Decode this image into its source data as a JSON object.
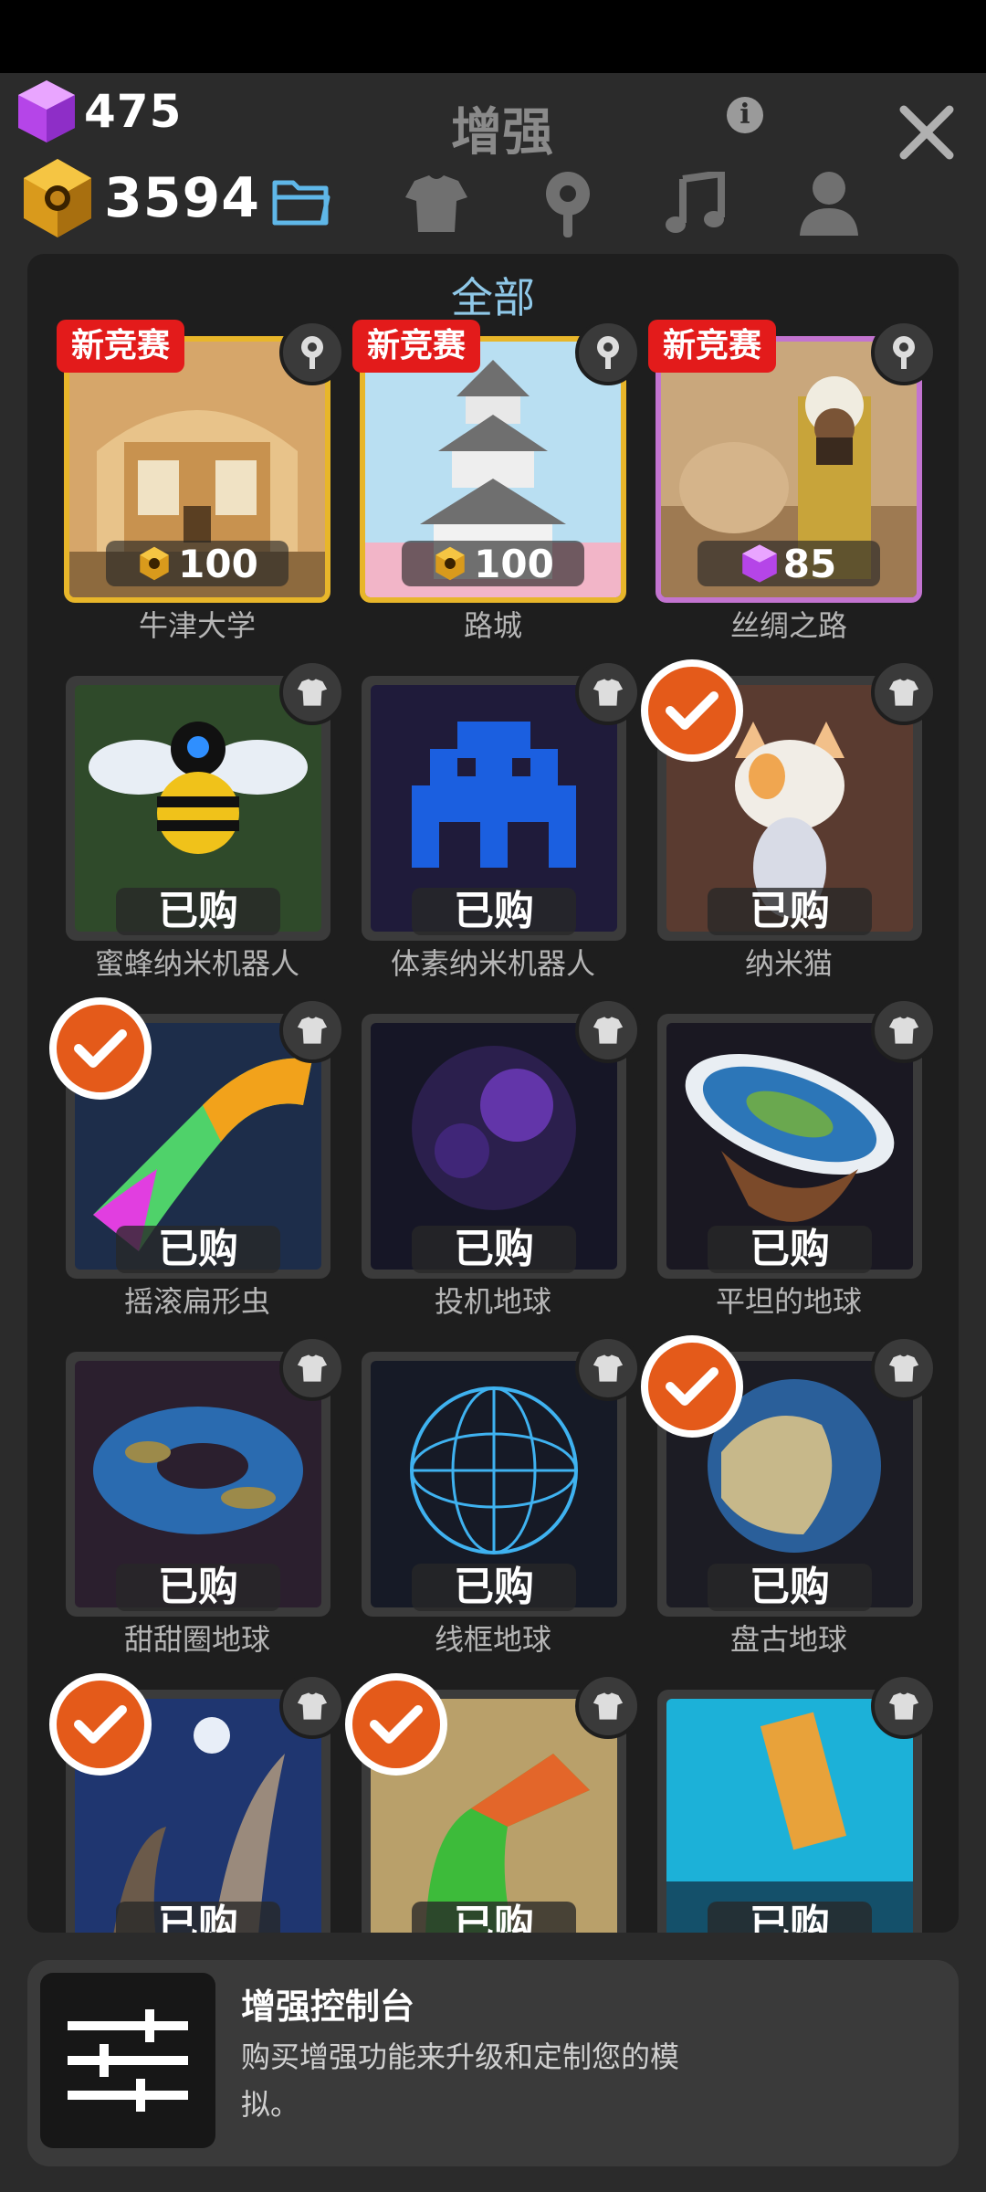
{
  "header": {
    "title": "增强",
    "gem_count": "475",
    "hex_count": "3594"
  },
  "panel": {
    "title": "全部"
  },
  "items": [
    {
      "name": "牛津大学",
      "type": "location",
      "new_tag": "新竞赛",
      "price": "100",
      "currency": "hex"
    },
    {
      "name": "路城",
      "type": "location",
      "new_tag": "新竞赛",
      "price": "100",
      "currency": "hex"
    },
    {
      "name": "丝绸之路",
      "type": "location",
      "new_tag": "新竞赛",
      "price": "85",
      "currency": "gem"
    },
    {
      "name": "蜜蜂纳米机器人",
      "type": "skin",
      "status": "已购",
      "selected": false
    },
    {
      "name": "体素纳米机器人",
      "type": "skin",
      "status": "已购",
      "selected": false
    },
    {
      "name": "纳米猫",
      "type": "skin",
      "status": "已购",
      "selected": true
    },
    {
      "name": "摇滚扁形虫",
      "type": "skin",
      "status": "已购",
      "selected": true
    },
    {
      "name": "投机地球",
      "type": "skin",
      "status": "已购",
      "selected": false
    },
    {
      "name": "平坦的地球",
      "type": "skin",
      "status": "已购",
      "selected": false
    },
    {
      "name": "甜甜圈地球",
      "type": "skin",
      "status": "已购",
      "selected": false
    },
    {
      "name": "线框地球",
      "type": "skin",
      "status": "已购",
      "selected": false
    },
    {
      "name": "盘古地球",
      "type": "skin",
      "status": "已购",
      "selected": true
    },
    {
      "name": "",
      "type": "skin",
      "status": "已购",
      "selected": true
    },
    {
      "name": "",
      "type": "skin",
      "status": "已购",
      "selected": true
    },
    {
      "name": "",
      "type": "skin",
      "status": "已购",
      "selected": false
    }
  ],
  "console": {
    "title": "增强控制台",
    "description": "购买增强功能来升级和定制您的模拟。"
  },
  "colors": {
    "background": "#2b2b2b",
    "panel": "#1e1e1e",
    "gold_border": "#e8b62a",
    "purple_border": "#c374d0",
    "new_tag": "#e31b1b",
    "check": "#e45a1a",
    "panel_title": "#8fc8e8"
  }
}
